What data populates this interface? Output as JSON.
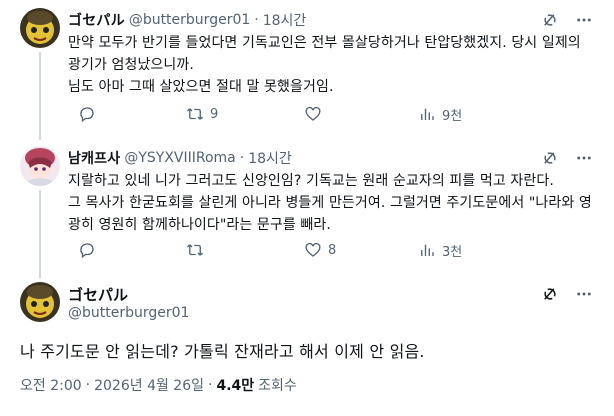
{
  "tweets": [
    {
      "name": "ゴセパル",
      "handle": "@butterburger01",
      "separator": "·",
      "time": "18시간",
      "text": "만약 모두가 반기를 들었다면 기독교인은 전부 몰살당하거나 탄압당했겠지. 당시 일제의 광기가 엄청났으니까.\n님도 아마 그때 살았으면 절대 말 못했을거임.",
      "replies": "",
      "retweets": "9",
      "likes": "",
      "views": "9천"
    },
    {
      "name": "남캐프사",
      "handle": "@YSYXVIIIRoma",
      "separator": "·",
      "time": "18시간",
      "text": "지랄하고 있네 니가 그러고도 신앙인임? 기독교는 원래 순교자의 피를 먹고 자란다.\n그 목사가 한굳됴회를 살린게 아니라 병들게 만든거여. 그럴거면 주기도문에서 \"나라와 영광히 영원히 함께하나이다\"라는 문구를 빼라.",
      "replies": "",
      "retweets": "",
      "likes": "8",
      "views": "3천"
    }
  ],
  "main_tweet": {
    "name": "ゴセパル",
    "handle": "@butterburger01",
    "text": "나 주기도문 안 읽는데? 가톨릭 잔재라고 해서 이제 안 읽음.",
    "time": "오전 2:00",
    "separator": "·",
    "date": "2026년 4월 26일",
    "views_count": "4.4만",
    "views_label": "조회수"
  },
  "icons": {
    "grok": "grok-icon",
    "more": "more-icon",
    "reply": "reply-icon",
    "retweet": "retweet-icon",
    "like": "like-icon",
    "views": "views-icon"
  },
  "colors": {
    "text": "#0f1419",
    "secondary": "#536471",
    "thread_line": "#cfd9de"
  }
}
